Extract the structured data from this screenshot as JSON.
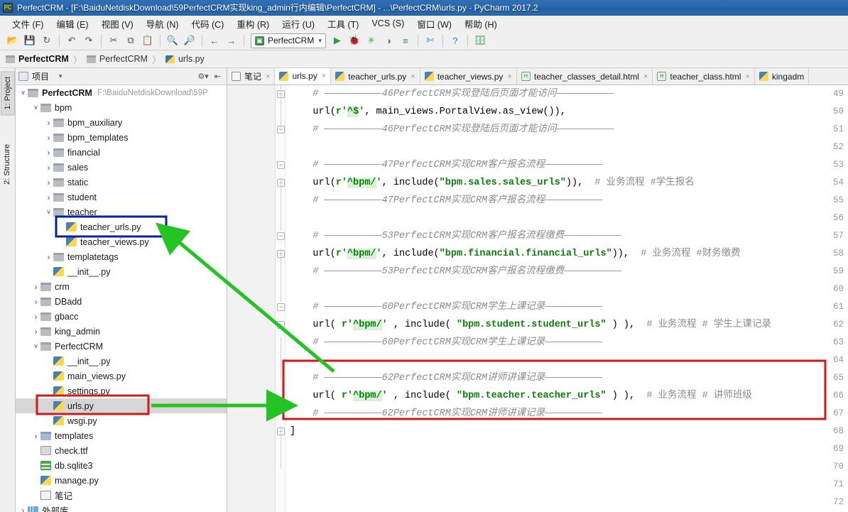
{
  "window": {
    "title": "PerfectCRM - [F:\\BaiduNetdiskDownload\\59PerfectCRM实现king_admin行内编辑\\PerfectCRM] - ...\\PerfectCRM\\urls.py - PyCharm 2017.2",
    "app_icon": "pycharm-icon"
  },
  "menubar": {
    "items": [
      {
        "label": "文件 (F)"
      },
      {
        "label": "编辑 (E)"
      },
      {
        "label": "视图 (V)"
      },
      {
        "label": "导航 (N)"
      },
      {
        "label": "代码 (C)"
      },
      {
        "label": "重构 (R)"
      },
      {
        "label": "运行 (U)"
      },
      {
        "label": "工具 (T)"
      },
      {
        "label": "VCS (S)"
      },
      {
        "label": "窗口 (W)"
      },
      {
        "label": "帮助 (H)"
      }
    ]
  },
  "toolbar": {
    "buttons": [
      {
        "name": "open-folder-icon",
        "glyph": "📂"
      },
      {
        "name": "save-all-icon",
        "glyph": "💾"
      },
      {
        "name": "sync-icon",
        "glyph": "↻"
      },
      {
        "sep": true
      },
      {
        "name": "undo-icon",
        "glyph": "↶"
      },
      {
        "name": "redo-icon",
        "glyph": "↷"
      },
      {
        "sep": true
      },
      {
        "name": "cut-icon",
        "glyph": "✂"
      },
      {
        "name": "copy-icon",
        "glyph": "⧉"
      },
      {
        "name": "paste-icon",
        "glyph": "📋"
      },
      {
        "sep": true
      },
      {
        "name": "find-icon",
        "glyph": "🔍"
      },
      {
        "name": "replace-icon",
        "glyph": "🔎"
      },
      {
        "sep": true
      },
      {
        "name": "back-icon",
        "glyph": "←"
      },
      {
        "name": "forward-icon",
        "glyph": "→"
      },
      {
        "sep": true
      }
    ],
    "run_config": {
      "label": "PerfectCRM",
      "caret": "▾"
    },
    "run_buttons": [
      {
        "name": "run-icon",
        "glyph": "▶",
        "color": "#2f9e3f"
      },
      {
        "name": "debug-icon",
        "glyph": "🐞",
        "color": "#3f8f4f"
      },
      {
        "name": "coverage-icon",
        "glyph": "✳",
        "color": "#4f9f5f"
      },
      {
        "name": "profile-icon",
        "glyph": "◑",
        "color": "#3f8f4f"
      },
      {
        "name": "run-with-console-icon",
        "glyph": "≡",
        "color": "#3f8f4f"
      },
      {
        "sep": true
      },
      {
        "name": "inspect-icon",
        "glyph": "✄",
        "color": "#2f7fbf"
      },
      {
        "sep": true
      },
      {
        "name": "help-icon",
        "glyph": "?",
        "color": "#2f7fbf"
      },
      {
        "sep": true
      },
      {
        "name": "database-icon",
        "glyph": "🗄",
        "color": "#3f8f4f"
      }
    ]
  },
  "breadcrumb": {
    "items": [
      {
        "label": "PerfectCRM",
        "icon": "folder-icon"
      },
      {
        "label": "PerfectCRM",
        "icon": "folder-icon"
      },
      {
        "label": "urls.py",
        "icon": "python-file-icon"
      }
    ],
    "separator": "〉"
  },
  "vertical_tabs": [
    {
      "label": "1: Project",
      "active": true
    },
    {
      "label": "2: Structure",
      "active": false
    }
  ],
  "project_panel": {
    "header": {
      "title": "项目",
      "caret": "▾",
      "settings_icon": "gear-icon",
      "collapse_icon": "collapse-icon"
    },
    "tree": [
      {
        "indent": 0,
        "arrow": "open",
        "icon": "folder",
        "label": "PerfectCRM",
        "bold": true,
        "path": "F:\\BaiduNetdiskDownload\\59P"
      },
      {
        "indent": 1,
        "arrow": "open",
        "icon": "folder",
        "label": "bpm"
      },
      {
        "indent": 2,
        "arrow": "closed",
        "icon": "folder",
        "label": "bpm_auxiliary"
      },
      {
        "indent": 2,
        "arrow": "closed",
        "icon": "folder",
        "label": "bpm_templates"
      },
      {
        "indent": 2,
        "arrow": "closed",
        "icon": "folder",
        "label": "financial"
      },
      {
        "indent": 2,
        "arrow": "closed",
        "icon": "folder",
        "label": "sales"
      },
      {
        "indent": 2,
        "arrow": "closed",
        "icon": "folder",
        "label": "static"
      },
      {
        "indent": 2,
        "arrow": "closed",
        "icon": "folder",
        "label": "student"
      },
      {
        "indent": 2,
        "arrow": "open",
        "icon": "folder",
        "label": "teacher"
      },
      {
        "indent": 3,
        "arrow": "none",
        "icon": "python",
        "label": "teacher_urls.py"
      },
      {
        "indent": 3,
        "arrow": "none",
        "icon": "python",
        "label": "teacher_views.py"
      },
      {
        "indent": 2,
        "arrow": "closed",
        "icon": "folder",
        "label": "templatetags"
      },
      {
        "indent": 2,
        "arrow": "none",
        "icon": "python",
        "label": "__init__.py"
      },
      {
        "indent": 1,
        "arrow": "closed",
        "icon": "folder",
        "label": "crm"
      },
      {
        "indent": 1,
        "arrow": "closed",
        "icon": "folder",
        "label": "DBadd"
      },
      {
        "indent": 1,
        "arrow": "closed",
        "icon": "folder",
        "label": "gbacc"
      },
      {
        "indent": 1,
        "arrow": "closed",
        "icon": "folder",
        "label": "king_admin"
      },
      {
        "indent": 1,
        "arrow": "open",
        "icon": "folder",
        "label": "PerfectCRM"
      },
      {
        "indent": 2,
        "arrow": "none",
        "icon": "python",
        "label": "__init__.py"
      },
      {
        "indent": 2,
        "arrow": "none",
        "icon": "python",
        "label": "main_views.py"
      },
      {
        "indent": 2,
        "arrow": "none",
        "icon": "python",
        "label": "settings.py"
      },
      {
        "indent": 2,
        "arrow": "none",
        "icon": "python",
        "label": "urls.py",
        "selected": true
      },
      {
        "indent": 2,
        "arrow": "none",
        "icon": "python",
        "label": "wsgi.py"
      },
      {
        "indent": 1,
        "arrow": "closed",
        "icon": "folder-blue",
        "label": "templates"
      },
      {
        "indent": 1,
        "arrow": "none",
        "icon": "ttf",
        "label": "check.ttf"
      },
      {
        "indent": 1,
        "arrow": "none",
        "icon": "db",
        "label": "db.sqlite3"
      },
      {
        "indent": 1,
        "arrow": "none",
        "icon": "python",
        "label": "manage.py"
      },
      {
        "indent": 1,
        "arrow": "none",
        "icon": "note",
        "label": "笔记"
      },
      {
        "indent": 0,
        "arrow": "closed",
        "icon": "lib",
        "label": "外部库"
      }
    ]
  },
  "editor_tabs": [
    {
      "label": "笔记",
      "icon": "note-file-icon",
      "active": false,
      "close": "×"
    },
    {
      "label": "urls.py",
      "icon": "python-file-icon",
      "active": true,
      "close": "×"
    },
    {
      "label": "teacher_urls.py",
      "icon": "python-file-icon",
      "active": false,
      "close": "×"
    },
    {
      "label": "teacher_views.py",
      "icon": "python-file-icon",
      "active": false,
      "close": "×"
    },
    {
      "label": "teacher_classes_detail.html",
      "icon": "html-file-icon",
      "active": false,
      "close": "×"
    },
    {
      "label": "teacher_class.html",
      "icon": "html-file-icon",
      "active": false,
      "close": "×"
    },
    {
      "label": "kingadm",
      "icon": "python-file-icon",
      "active": false,
      "close": ""
    }
  ],
  "editor": {
    "first_line_number": 49,
    "lines": [
      {
        "n": 49,
        "fold": "collapse",
        "segs": [
          {
            "t": "    # ——————————46PerfectCRM实现登陆后页面才能访问——————————",
            "c": "cmt"
          }
        ]
      },
      {
        "n": 50,
        "fold": "",
        "segs": [
          {
            "t": "    url(",
            "c": "kw"
          },
          {
            "t": "r'",
            "c": "rpfx"
          },
          {
            "t": "^$",
            "c": "rex"
          },
          {
            "t": "'",
            "c": "rpfx"
          },
          {
            "t": ", main_views.PortalView.as_view()),",
            "c": "kw"
          }
        ]
      },
      {
        "n": 51,
        "fold": "collapse",
        "segs": [
          {
            "t": "    # ——————————46PerfectCRM实现登陆后页面才能访问——————————",
            "c": "cmt"
          }
        ]
      },
      {
        "n": 52,
        "fold": "",
        "segs": [
          {
            "t": "",
            "c": "kw"
          }
        ]
      },
      {
        "n": 53,
        "fold": "collapse",
        "segs": [
          {
            "t": "    # ——————————47PerfectCRM实现CRM客户报名流程——————————",
            "c": "cmt"
          }
        ]
      },
      {
        "n": 54,
        "fold": "collapse",
        "segs": [
          {
            "t": "    url(",
            "c": "kw"
          },
          {
            "t": "r'",
            "c": "rpfx"
          },
          {
            "t": "^bpm/",
            "c": "rex"
          },
          {
            "t": "'",
            "c": "rpfx"
          },
          {
            "t": ", include(",
            "c": "kw"
          },
          {
            "t": "\"bpm.sales.sales_urls\"",
            "c": "str"
          },
          {
            "t": ")),",
            "c": "kw"
          },
          {
            "t": "  # 业务流程 #学生报名",
            "c": "cmt-plain"
          }
        ]
      },
      {
        "n": 55,
        "fold": "",
        "segs": [
          {
            "t": "    # ——————————47PerfectCRM实现CRM客户报名流程——————————",
            "c": "cmt"
          }
        ]
      },
      {
        "n": 56,
        "fold": "",
        "segs": [
          {
            "t": "",
            "c": "kw"
          }
        ]
      },
      {
        "n": 57,
        "fold": "collapse",
        "segs": [
          {
            "t": "    # ——————————53PerfectCRM实现CRM客户报名流程缴费——————————",
            "c": "cmt"
          }
        ]
      },
      {
        "n": 58,
        "fold": "collapse",
        "segs": [
          {
            "t": "    url(",
            "c": "kw"
          },
          {
            "t": "r'",
            "c": "rpfx"
          },
          {
            "t": "^bpm/",
            "c": "rex"
          },
          {
            "t": "'",
            "c": "rpfx"
          },
          {
            "t": ", include(",
            "c": "kw"
          },
          {
            "t": "\"bpm.financial.financial_urls\"",
            "c": "str"
          },
          {
            "t": ")),",
            "c": "kw"
          },
          {
            "t": "  # 业务流程 #财务缴费",
            "c": "cmt-plain"
          }
        ]
      },
      {
        "n": 59,
        "fold": "",
        "segs": [
          {
            "t": "    # ——————————53PerfectCRM实现CRM客户报名流程缴费——————————",
            "c": "cmt"
          }
        ]
      },
      {
        "n": 60,
        "fold": "",
        "segs": [
          {
            "t": "",
            "c": "kw"
          }
        ]
      },
      {
        "n": 61,
        "fold": "collapse",
        "segs": [
          {
            "t": "    # ——————————60PerfectCRM实现CRM学生上课记录——————————",
            "c": "cmt"
          }
        ]
      },
      {
        "n": 62,
        "fold": "collapse",
        "segs": [
          {
            "t": "    url( ",
            "c": "kw"
          },
          {
            "t": "r'",
            "c": "rpfx"
          },
          {
            "t": "^bpm/",
            "c": "rex"
          },
          {
            "t": "'",
            "c": "rpfx"
          },
          {
            "t": " , include( ",
            "c": "kw"
          },
          {
            "t": "\"bpm.student.student_urls\"",
            "c": "str"
          },
          {
            "t": " ) ),",
            "c": "kw"
          },
          {
            "t": "  # 业务流程 # 学生上课记录",
            "c": "cmt-plain"
          }
        ]
      },
      {
        "n": 63,
        "fold": "",
        "segs": [
          {
            "t": "    # ——————————60PerfectCRM实现CRM学生上课记录——————————",
            "c": "cmt"
          }
        ]
      },
      {
        "n": 64,
        "fold": "",
        "segs": [
          {
            "t": "",
            "c": "kw"
          }
        ]
      },
      {
        "n": 65,
        "fold": "",
        "segs": [
          {
            "t": "    # ——————————62PerfectCRM实现CRM讲师讲课记录——————————",
            "c": "cmt"
          }
        ]
      },
      {
        "n": 66,
        "fold": "",
        "segs": [
          {
            "t": "    url( ",
            "c": "kw"
          },
          {
            "t": "r'",
            "c": "rpfx"
          },
          {
            "t": "^bpm/",
            "c": "rex"
          },
          {
            "t": "'",
            "c": "rpfx"
          },
          {
            "t": " , include( ",
            "c": "kw"
          },
          {
            "t": "\"bpm.teacher.teacher_urls\"",
            "c": "str"
          },
          {
            "t": " ) ),",
            "c": "kw"
          },
          {
            "t": "  # 业务流程 # 讲师班级",
            "c": "cmt-plain"
          }
        ]
      },
      {
        "n": 67,
        "fold": "",
        "segs": [
          {
            "t": "    # ——————————62PerfectCRM实现CRM讲师讲课记录——————————",
            "c": "cmt"
          }
        ]
      },
      {
        "n": 68,
        "fold": "collapse",
        "segs": [
          {
            "t": "]",
            "c": "kw"
          }
        ]
      },
      {
        "n": 69,
        "fold": "",
        "segs": [
          {
            "t": "",
            "c": "kw"
          }
        ]
      },
      {
        "n": 70,
        "fold": "",
        "segs": [
          {
            "t": "",
            "c": "kw"
          }
        ]
      },
      {
        "n": 71,
        "fold": "",
        "segs": [
          {
            "t": "",
            "c": "kw"
          }
        ]
      },
      {
        "n": 72,
        "fold": "",
        "segs": [
          {
            "t": "",
            "c": "kw"
          }
        ]
      }
    ]
  },
  "annotations": {
    "blue_box_label": "teacher_urls.py-highlight",
    "red_box_tree_label": "urls.py-highlight",
    "red_box_editor_label": "teacher-url-block-highlight",
    "arrow_color": "#22c322",
    "blue_color": "#0a1fa0",
    "red_color": "#cf1a1a"
  }
}
